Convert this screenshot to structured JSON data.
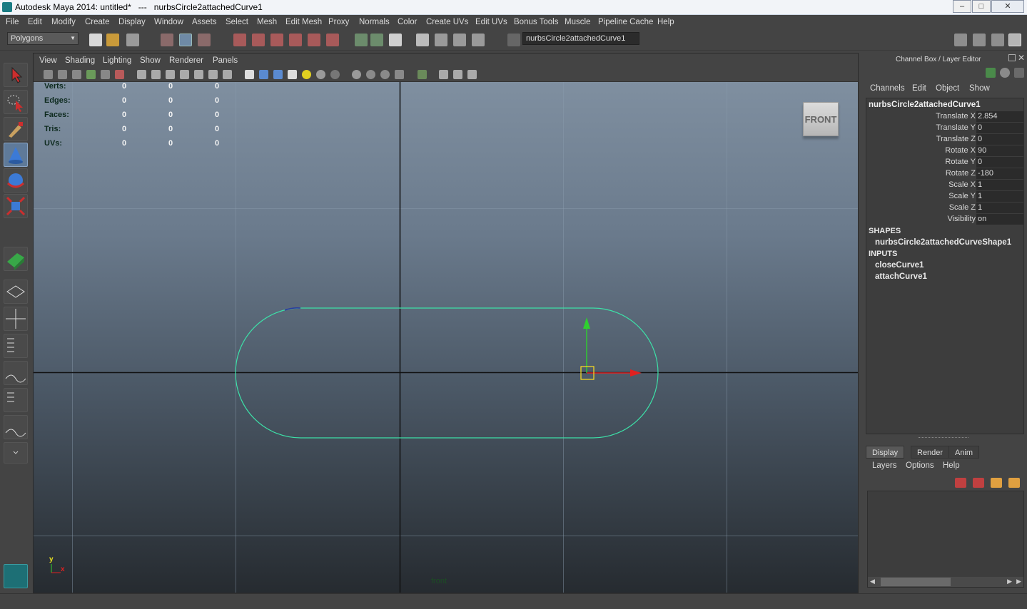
{
  "window": {
    "title": "Autodesk Maya 2014: untitled*   ---   nurbsCircle2attachedCurve1",
    "minimize": "–",
    "maximize": "□",
    "close": "✕"
  },
  "menubar": [
    "File",
    "Edit",
    "Modify",
    "Create",
    "Display",
    "Window",
    "Assets",
    "Select",
    "Mesh",
    "Edit Mesh",
    "Proxy",
    "Normals",
    "Color",
    "Create UVs",
    "Edit UVs",
    "Bonus Tools",
    "Muscle",
    "Pipeline Cache",
    "Help"
  ],
  "statusline": {
    "mode": "Polygons",
    "name_field": "nurbsCircle2attachedCurve1"
  },
  "viewport": {
    "menu": [
      "View",
      "Shading",
      "Lighting",
      "Show",
      "Renderer",
      "Panels"
    ],
    "hud": [
      {
        "label": "Verts:",
        "values": [
          "0",
          "0",
          "0"
        ]
      },
      {
        "label": "Edges:",
        "values": [
          "0",
          "0",
          "0"
        ]
      },
      {
        "label": "Faces:",
        "values": [
          "0",
          "0",
          "0"
        ]
      },
      {
        "label": "Tris:",
        "values": [
          "0",
          "0",
          "0"
        ]
      },
      {
        "label": "UVs:",
        "values": [
          "0",
          "0",
          "0"
        ]
      }
    ],
    "viewcube": "FRONT",
    "camera": "front",
    "axis_y": "y",
    "axis_x": "x",
    "curve_color": "#3de0a8"
  },
  "channel_box": {
    "header": "Channel Box / Layer Editor",
    "menu": [
      "Channels",
      "Edit",
      "Object",
      "Show"
    ],
    "object": "nurbsCircle2attachedCurve1",
    "attributes": [
      {
        "label": "Translate X",
        "value": "2.854"
      },
      {
        "label": "Translate Y",
        "value": "0"
      },
      {
        "label": "Translate Z",
        "value": "0"
      },
      {
        "label": "Rotate X",
        "value": "90"
      },
      {
        "label": "Rotate Y",
        "value": "0"
      },
      {
        "label": "Rotate Z",
        "value": "-180"
      },
      {
        "label": "Scale X",
        "value": "1"
      },
      {
        "label": "Scale Y",
        "value": "1"
      },
      {
        "label": "Scale Z",
        "value": "1"
      },
      {
        "label": "Visibility",
        "value": "on"
      }
    ],
    "shapes_label": "SHAPES",
    "shape": "nurbsCircle2attachedCurveShape1",
    "inputs_label": "INPUTS",
    "inputs": [
      "closeCurve1",
      "attachCurve1"
    ]
  },
  "layer_editor": {
    "tabs": [
      "Display",
      "Render",
      "Anim"
    ],
    "menu": [
      "Layers",
      "Options",
      "Help"
    ]
  }
}
